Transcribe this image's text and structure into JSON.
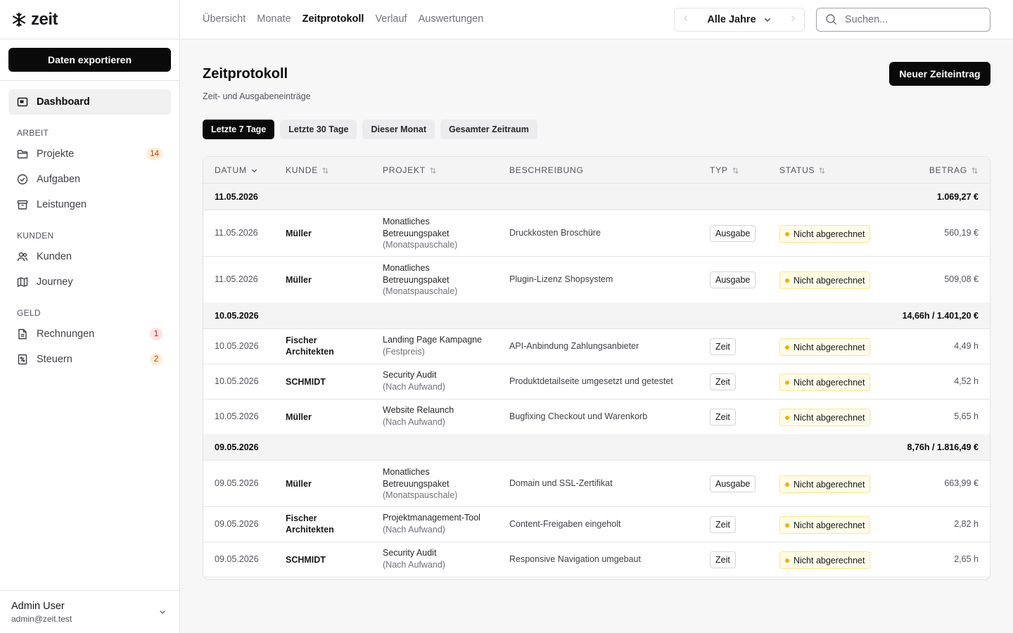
{
  "app": {
    "logo_text": "zeit"
  },
  "sidebar": {
    "export_label": "Daten exportieren",
    "dashboard_label": "Dashboard",
    "sections": {
      "arbeit": "ARBEIT",
      "kunden": "KUNDEN",
      "geld": "GELD"
    },
    "items": [
      {
        "label": "Projekte",
        "badge": "14"
      },
      {
        "label": "Aufgaben"
      },
      {
        "label": "Leistungen"
      },
      {
        "label": "Kunden"
      },
      {
        "label": "Journey"
      },
      {
        "label": "Rechnungen",
        "badge": "1"
      },
      {
        "label": "Steuern",
        "badge": "2"
      }
    ],
    "user": {
      "name": "Admin User",
      "email": "admin@zeit.test"
    }
  },
  "topnav": {
    "tabs": [
      "Übersicht",
      "Monate",
      "Zeitprotokoll",
      "Verlauf",
      "Auswertungen"
    ],
    "active": "Zeitprotokoll",
    "year_label": "Alle Jahre",
    "search_placeholder": "Suchen..."
  },
  "main": {
    "title": "Zeitprotokoll",
    "subtitle": "Zeit- und Ausgabeneinträge",
    "new_button": "Neuer Zeiteintrag",
    "filters": [
      "Letzte 7 Tage",
      "Letzte 30 Tage",
      "Dieser Monat",
      "Gesamter Zeitraum"
    ],
    "active_filter": "Letzte 7 Tage"
  },
  "table": {
    "headers": [
      "DATUM",
      "KUNDE",
      "PROJEKT",
      "BESCHREIBUNG",
      "TYP",
      "STATUS",
      "BETRAG"
    ],
    "groups": [
      {
        "date": "11.05.2026",
        "sum": "1.069,27 €",
        "rows": [
          {
            "date": "11.05.2026",
            "kunde": [
              "Müller"
            ],
            "projekt": [
              "Monatliches",
              "Betreuungspaket"
            ],
            "projekt_typ": "(Monatspauschale)",
            "beschreibung": "Druckkosten Broschüre",
            "typ": "Ausgabe",
            "status": "Nicht abgerechnet",
            "betrag": "560,19 €"
          },
          {
            "date": "11.05.2026",
            "kunde": [
              "Müller"
            ],
            "projekt": [
              "Monatliches",
              "Betreuungspaket"
            ],
            "projekt_typ": "(Monatspauschale)",
            "beschreibung": "Plugin-Lizenz Shopsystem",
            "typ": "Ausgabe",
            "status": "Nicht abgerechnet",
            "betrag": "509,08 €"
          }
        ]
      },
      {
        "date": "10.05.2026",
        "sum": "14,66h / 1.401,20 €",
        "rows": [
          {
            "date": "10.05.2026",
            "kunde": [
              "Fischer",
              "Architekten"
            ],
            "projekt": [
              "Landing Page Kampagne"
            ],
            "projekt_typ": "(Festpreis)",
            "beschreibung": "API-Anbindung Zahlungsanbieter",
            "typ": "Zeit",
            "status": "Nicht abgerechnet",
            "betrag": "4,49 h"
          },
          {
            "date": "10.05.2026",
            "kunde": [
              "SCHMIDT"
            ],
            "projekt": [
              "Security Audit"
            ],
            "projekt_typ": "(Nach Aufwand)",
            "beschreibung": "Produktdetailseite umgesetzt und getestet",
            "typ": "Zeit",
            "status": "Nicht abgerechnet",
            "betrag": "4,52 h"
          },
          {
            "date": "10.05.2026",
            "kunde": [
              "Müller"
            ],
            "projekt": [
              "Website Relaunch"
            ],
            "projekt_typ": "(Nach Aufwand)",
            "beschreibung": "Bugfixing Checkout und Warenkorb",
            "typ": "Zeit",
            "status": "Nicht abgerechnet",
            "betrag": "5,65 h"
          }
        ]
      },
      {
        "date": "09.05.2026",
        "sum": "8,76h / 1.816,49 €",
        "rows": [
          {
            "date": "09.05.2026",
            "kunde": [
              "Müller"
            ],
            "projekt": [
              "Monatliches",
              "Betreuungspaket"
            ],
            "projekt_typ": "(Monatspauschale)",
            "beschreibung": "Domain und SSL-Zertifikat",
            "typ": "Ausgabe",
            "status": "Nicht abgerechnet",
            "betrag": "663,99 €"
          },
          {
            "date": "09.05.2026",
            "kunde": [
              "Fischer",
              "Architekten"
            ],
            "projekt": [
              "Projektmanagement-Tool"
            ],
            "projekt_typ": "(Nach Aufwand)",
            "beschreibung": "Content-Freigaben eingeholt",
            "typ": "Zeit",
            "status": "Nicht abgerechnet",
            "betrag": "2,82 h"
          },
          {
            "date": "09.05.2026",
            "kunde": [
              "SCHMIDT"
            ],
            "projekt": [
              "Security Audit"
            ],
            "projekt_typ": "(Nach Aufwand)",
            "beschreibung": "Responsive Navigation umgebaut",
            "typ": "Zeit",
            "status": "Nicht abgerechnet",
            "betrag": "2,65 h"
          }
        ]
      }
    ]
  }
}
